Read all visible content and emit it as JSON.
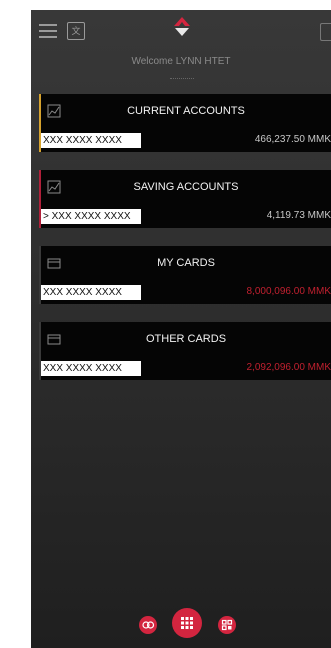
{
  "header": {
    "welcome_text": "Welcome LYNN HTET"
  },
  "accounts": [
    {
      "title": "CURRENT ACCOUNTS",
      "number": "XXX XXXX XXXX",
      "amount": "466,237.50 MMK"
    },
    {
      "title": "SAVING ACCOUNTS",
      "number": "> XXX XXXX XXXX",
      "amount": "4,119.73 MMK"
    },
    {
      "title": "MY CARDS",
      "number": "XXX XXXX XXXX",
      "amount": "8,000,096.00 MMK"
    },
    {
      "title": "OTHER CARDS",
      "number": "XXX XXXX XXXX",
      "amount": "2,092,096.00 MMK"
    }
  ],
  "icons": {
    "menu": "menu-icon",
    "translate": "translate-icon",
    "logo": "bank-logo-icon",
    "chart": "chart-icon",
    "card": "card-icon",
    "nav_left": "settings-icon",
    "nav_center": "grid-menu-icon",
    "nav_right": "qr-icon"
  },
  "colors": {
    "current_accent": "#d7a32e",
    "saving_accent": "#b1203a",
    "red_amount": "#c0202f",
    "nav_button": "#d3253f"
  }
}
